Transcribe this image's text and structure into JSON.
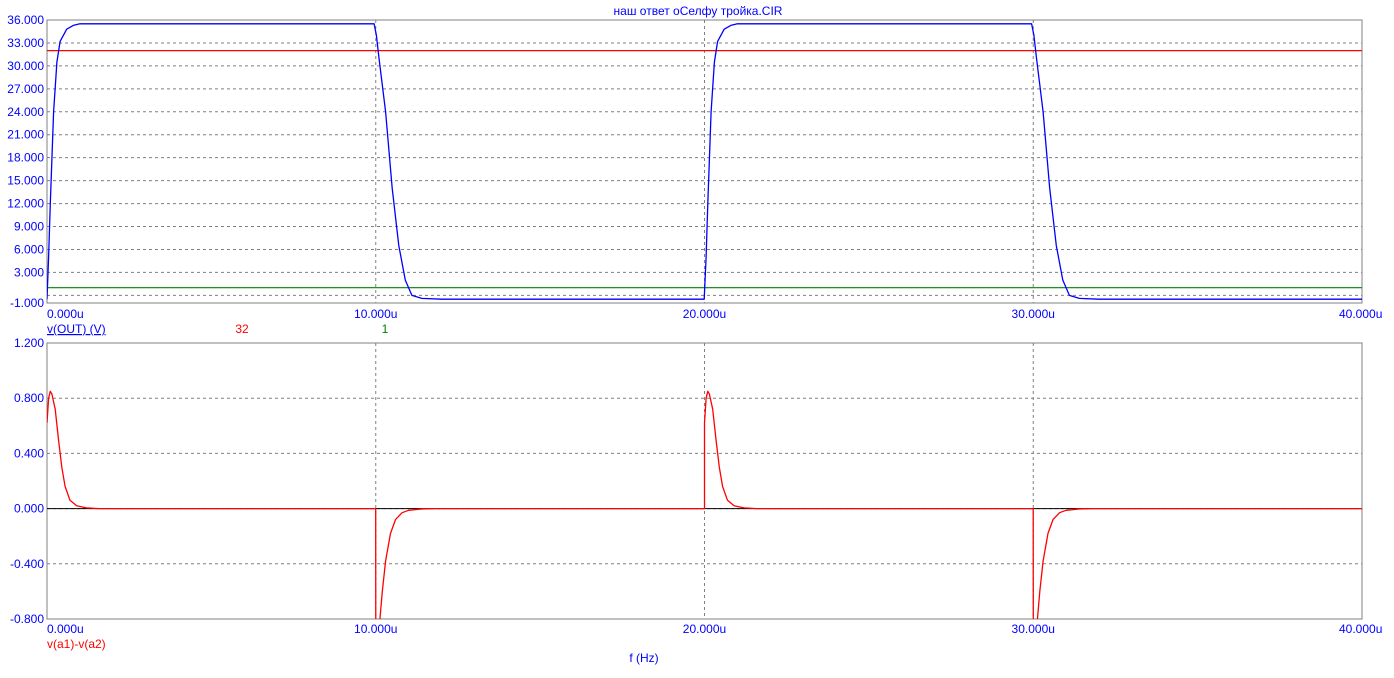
{
  "chart_data": [
    {
      "type": "line",
      "title": "наш ответ оСелфу тройка.CIR",
      "xlabel": "",
      "ylabel": "",
      "legend": "v(OUT) (V)",
      "xlim": [
        0,
        40
      ],
      "ylim": [
        -1,
        36
      ],
      "xticks": [
        "0.000u",
        "10.000u",
        "20.000u",
        "30.000u",
        "40.000u"
      ],
      "yticks": [
        "36.000",
        "33.000",
        "30.000",
        "27.000",
        "24.000",
        "21.000",
        "18.000",
        "15.000",
        "12.000",
        "9.000",
        "6.000",
        "3.000",
        "-1.000"
      ],
      "grid": true,
      "hlines": [
        {
          "value": 32,
          "label": "32",
          "color": "#ff0000"
        },
        {
          "value": 1,
          "label": "1",
          "color": "#008000"
        }
      ],
      "series": [
        {
          "name": "v(OUT) (V)",
          "color": "#0000ff",
          "x": [
            0,
            0.05,
            0.1,
            0.2,
            0.3,
            0.4,
            0.6,
            0.8,
            1,
            9.95,
            10.02,
            10.1,
            10.3,
            10.5,
            10.7,
            10.9,
            11.1,
            11.4,
            12,
            19.99,
            20.05,
            20.1,
            20.2,
            20.3,
            20.4,
            20.6,
            20.8,
            21,
            29.95,
            30.02,
            30.1,
            30.3,
            30.5,
            30.7,
            30.9,
            31.1,
            31.4,
            32,
            40
          ],
          "y": [
            -0.5,
            5,
            12,
            24,
            30.5,
            33.2,
            34.8,
            35.3,
            35.5,
            35.5,
            34,
            31,
            24,
            14,
            6.5,
            2,
            0,
            -0.4,
            -0.5,
            -0.5,
            5,
            12,
            24,
            30.5,
            33.2,
            34.8,
            35.3,
            35.5,
            35.5,
            34,
            31,
            24,
            14,
            6.5,
            2,
            0,
            -0.4,
            -0.5,
            -0.5
          ]
        }
      ]
    },
    {
      "type": "line",
      "xlabel": "f (Hz)",
      "legend": "v(a1)-v(a2)",
      "xlim": [
        0,
        40
      ],
      "ylim": [
        -0.8,
        1.2
      ],
      "xticks": [
        "0.000u",
        "10.000u",
        "20.000u",
        "30.000u",
        "40.000u"
      ],
      "yticks": [
        "1.200",
        "0.800",
        "0.400",
        "0.000",
        "-0.400",
        "-0.800"
      ],
      "grid": true,
      "series": [
        {
          "name": "v(a1)-v(a2)",
          "color": "#ff0000",
          "x": [
            0,
            0.05,
            0.1,
            0.15,
            0.25,
            0.35,
            0.45,
            0.55,
            0.7,
            0.9,
            1.2,
            1.6,
            9.999,
            10,
            10.12,
            10.2,
            10.3,
            10.45,
            10.6,
            10.8,
            11,
            11.4,
            11.8,
            19.999,
            20,
            20.05,
            20.1,
            20.15,
            20.25,
            20.35,
            20.45,
            20.55,
            20.7,
            20.9,
            21.2,
            21.6,
            29.999,
            30,
            30.12,
            30.2,
            30.3,
            30.45,
            30.6,
            30.8,
            31,
            31.4,
            31.8,
            40
          ],
          "y": [
            0.62,
            0.8,
            0.85,
            0.83,
            0.72,
            0.5,
            0.3,
            0.16,
            0.06,
            0.02,
            0.005,
            0,
            0,
            -1.2,
            -0.82,
            -0.6,
            -0.38,
            -0.18,
            -0.08,
            -0.03,
            -0.012,
            -0.003,
            0,
            0,
            0.62,
            0.8,
            0.85,
            0.83,
            0.72,
            0.5,
            0.3,
            0.16,
            0.06,
            0.02,
            0.005,
            0,
            0,
            -1.2,
            -0.82,
            -0.6,
            -0.38,
            -0.18,
            -0.08,
            -0.03,
            -0.012,
            -0.003,
            0,
            0
          ]
        }
      ]
    }
  ]
}
